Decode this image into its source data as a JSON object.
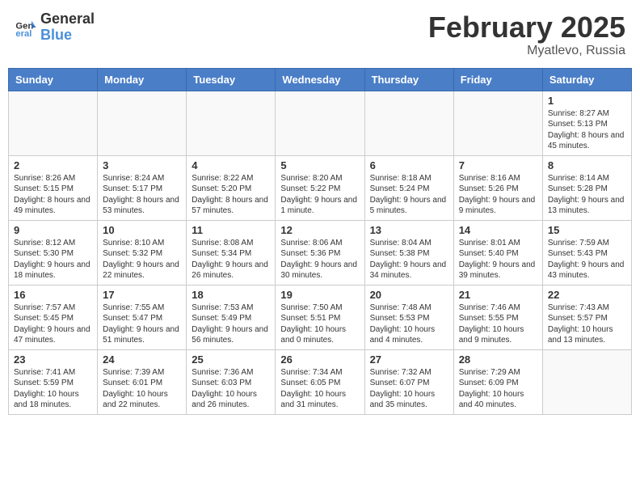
{
  "header": {
    "logo_line1": "General",
    "logo_line2": "Blue",
    "month_title": "February 2025",
    "location": "Myatlevo, Russia"
  },
  "weekdays": [
    "Sunday",
    "Monday",
    "Tuesday",
    "Wednesday",
    "Thursday",
    "Friday",
    "Saturday"
  ],
  "weeks": [
    [
      {
        "day": "",
        "info": ""
      },
      {
        "day": "",
        "info": ""
      },
      {
        "day": "",
        "info": ""
      },
      {
        "day": "",
        "info": ""
      },
      {
        "day": "",
        "info": ""
      },
      {
        "day": "",
        "info": ""
      },
      {
        "day": "1",
        "info": "Sunrise: 8:27 AM\nSunset: 5:13 PM\nDaylight: 8 hours and 45 minutes."
      }
    ],
    [
      {
        "day": "2",
        "info": "Sunrise: 8:26 AM\nSunset: 5:15 PM\nDaylight: 8 hours and 49 minutes."
      },
      {
        "day": "3",
        "info": "Sunrise: 8:24 AM\nSunset: 5:17 PM\nDaylight: 8 hours and 53 minutes."
      },
      {
        "day": "4",
        "info": "Sunrise: 8:22 AM\nSunset: 5:20 PM\nDaylight: 8 hours and 57 minutes."
      },
      {
        "day": "5",
        "info": "Sunrise: 8:20 AM\nSunset: 5:22 PM\nDaylight: 9 hours and 1 minute."
      },
      {
        "day": "6",
        "info": "Sunrise: 8:18 AM\nSunset: 5:24 PM\nDaylight: 9 hours and 5 minutes."
      },
      {
        "day": "7",
        "info": "Sunrise: 8:16 AM\nSunset: 5:26 PM\nDaylight: 9 hours and 9 minutes."
      },
      {
        "day": "8",
        "info": "Sunrise: 8:14 AM\nSunset: 5:28 PM\nDaylight: 9 hours and 13 minutes."
      }
    ],
    [
      {
        "day": "9",
        "info": "Sunrise: 8:12 AM\nSunset: 5:30 PM\nDaylight: 9 hours and 18 minutes."
      },
      {
        "day": "10",
        "info": "Sunrise: 8:10 AM\nSunset: 5:32 PM\nDaylight: 9 hours and 22 minutes."
      },
      {
        "day": "11",
        "info": "Sunrise: 8:08 AM\nSunset: 5:34 PM\nDaylight: 9 hours and 26 minutes."
      },
      {
        "day": "12",
        "info": "Sunrise: 8:06 AM\nSunset: 5:36 PM\nDaylight: 9 hours and 30 minutes."
      },
      {
        "day": "13",
        "info": "Sunrise: 8:04 AM\nSunset: 5:38 PM\nDaylight: 9 hours and 34 minutes."
      },
      {
        "day": "14",
        "info": "Sunrise: 8:01 AM\nSunset: 5:40 PM\nDaylight: 9 hours and 39 minutes."
      },
      {
        "day": "15",
        "info": "Sunrise: 7:59 AM\nSunset: 5:43 PM\nDaylight: 9 hours and 43 minutes."
      }
    ],
    [
      {
        "day": "16",
        "info": "Sunrise: 7:57 AM\nSunset: 5:45 PM\nDaylight: 9 hours and 47 minutes."
      },
      {
        "day": "17",
        "info": "Sunrise: 7:55 AM\nSunset: 5:47 PM\nDaylight: 9 hours and 51 minutes."
      },
      {
        "day": "18",
        "info": "Sunrise: 7:53 AM\nSunset: 5:49 PM\nDaylight: 9 hours and 56 minutes."
      },
      {
        "day": "19",
        "info": "Sunrise: 7:50 AM\nSunset: 5:51 PM\nDaylight: 10 hours and 0 minutes."
      },
      {
        "day": "20",
        "info": "Sunrise: 7:48 AM\nSunset: 5:53 PM\nDaylight: 10 hours and 4 minutes."
      },
      {
        "day": "21",
        "info": "Sunrise: 7:46 AM\nSunset: 5:55 PM\nDaylight: 10 hours and 9 minutes."
      },
      {
        "day": "22",
        "info": "Sunrise: 7:43 AM\nSunset: 5:57 PM\nDaylight: 10 hours and 13 minutes."
      }
    ],
    [
      {
        "day": "23",
        "info": "Sunrise: 7:41 AM\nSunset: 5:59 PM\nDaylight: 10 hours and 18 minutes."
      },
      {
        "day": "24",
        "info": "Sunrise: 7:39 AM\nSunset: 6:01 PM\nDaylight: 10 hours and 22 minutes."
      },
      {
        "day": "25",
        "info": "Sunrise: 7:36 AM\nSunset: 6:03 PM\nDaylight: 10 hours and 26 minutes."
      },
      {
        "day": "26",
        "info": "Sunrise: 7:34 AM\nSunset: 6:05 PM\nDaylight: 10 hours and 31 minutes."
      },
      {
        "day": "27",
        "info": "Sunrise: 7:32 AM\nSunset: 6:07 PM\nDaylight: 10 hours and 35 minutes."
      },
      {
        "day": "28",
        "info": "Sunrise: 7:29 AM\nSunset: 6:09 PM\nDaylight: 10 hours and 40 minutes."
      },
      {
        "day": "",
        "info": ""
      }
    ]
  ]
}
